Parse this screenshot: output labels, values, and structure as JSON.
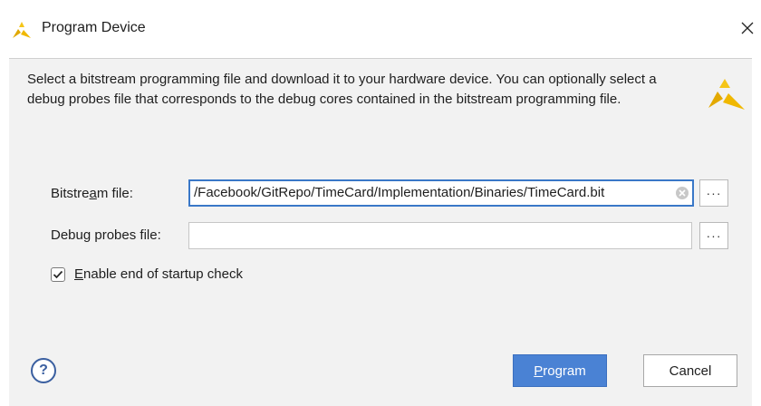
{
  "window": {
    "title": "Program Device",
    "logo_icon": "vivado-logo-icon",
    "close_icon": "close-icon"
  },
  "dialog": {
    "description": "Select a bitstream programming file and download it to your hardware device. You can optionally select a debug probes file that corresponds to the debug cores contained in the bitstream programming file.",
    "bitstream": {
      "label_a": "Bitstream file",
      "label_rest": ":",
      "underline_char": "a",
      "label_pre": "Bitstream file",
      "value": "/Facebook/GitRepo/TimeCard/Implementation/Binaries/TimeCard.bit",
      "browse_label": "···"
    },
    "debug": {
      "label_pre": "Debu",
      "underline_char": "g",
      "label_post": " probes file:",
      "value": "",
      "browse_label": "···"
    },
    "startup_check": {
      "underline_char": "E",
      "label_post": "nable end of startup check",
      "checked": true
    },
    "help_label": "?",
    "program_button": {
      "underline_char": "P",
      "label_post": "rogram"
    },
    "cancel_button": "Cancel"
  },
  "colors": {
    "accent": "#4a82d4",
    "background": "#f2f2f2",
    "logo": "#f0c020"
  }
}
